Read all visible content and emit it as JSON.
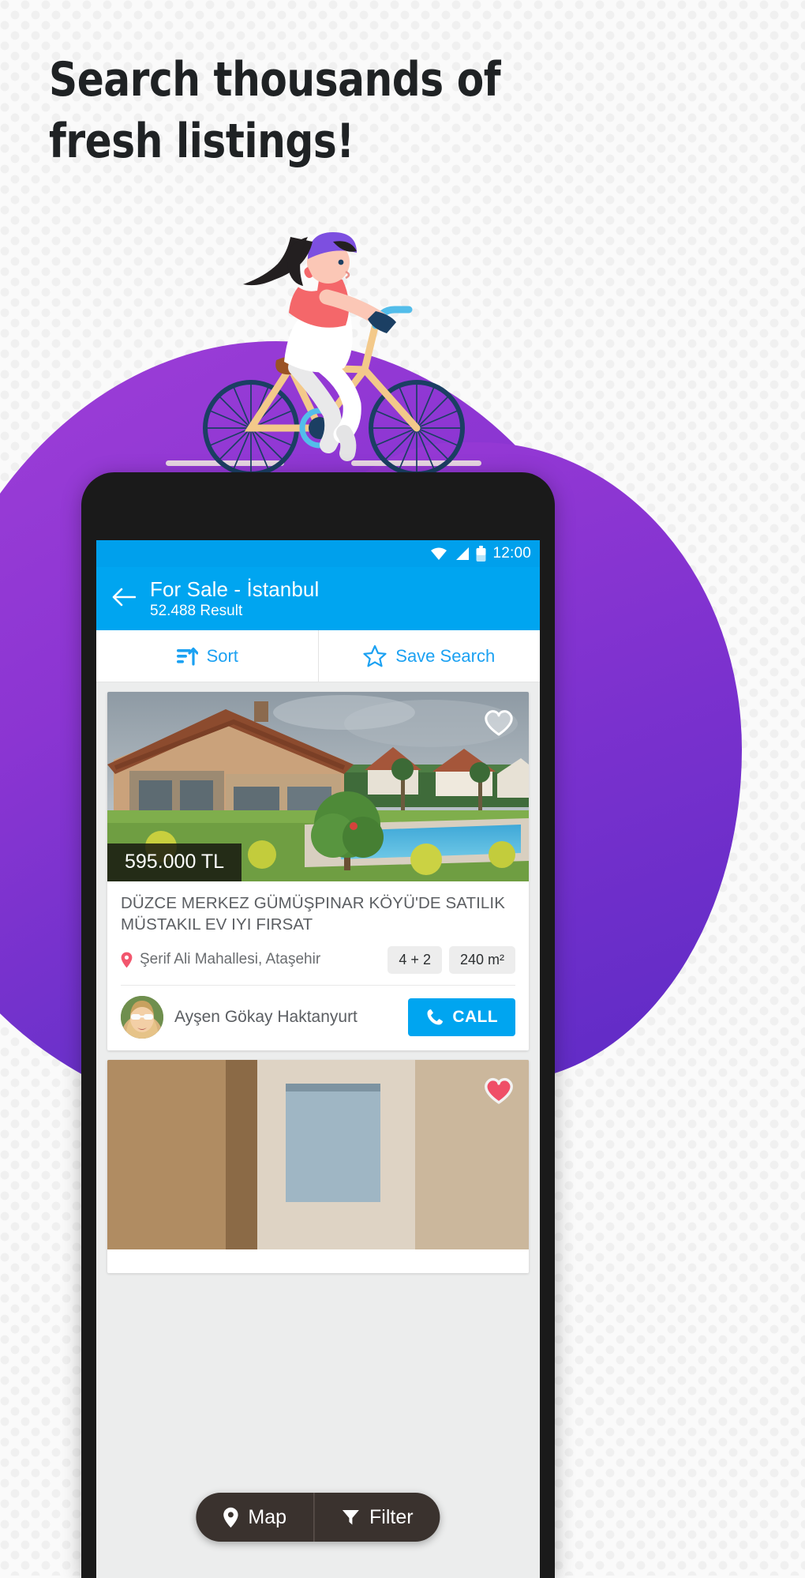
{
  "promo": {
    "headline": "Search thousands of\nfresh listings!",
    "illustration": "woman-riding-bicycle",
    "blob_color": "#7b31ce",
    "background_color": "#fafafa",
    "dot_color": "#f0f0f0"
  },
  "phone": {
    "frame_color": "#1a1a1a",
    "statusbar": {
      "time": "12:00",
      "background": "#00a0ec",
      "icons": [
        "wifi-icon",
        "signal-icon",
        "battery-icon"
      ]
    },
    "header": {
      "background": "#00a5f0",
      "back_icon": "back-arrow-icon",
      "title": "For Sale -  İstanbul",
      "subtitle": "52.488 Result"
    },
    "toolbar": {
      "accent": "#1ba1f2",
      "sort_label": "Sort",
      "sort_icon": "sort-lines-arrow-icon",
      "save_label": "Save Search",
      "save_icon": "star-outline-icon"
    },
    "listings": [
      {
        "price": "595.000 TL",
        "title": "DÜZCE MERKEZ GÜMÜŞPINAR KÖYÜ'DE SATILIK MÜSTAKIL EV IYI FIRSAT",
        "location": "Şerif Ali Mahallesi, Ataşehir",
        "location_icon": "map-pin-icon",
        "rooms": "4 + 2",
        "area": "240 m²",
        "favorite": false,
        "favorite_icon": "heart-outline-icon",
        "agent": "Ayşen Gökay Haktanyurt",
        "call_label": "CALL",
        "call_icon": "phone-icon"
      },
      {
        "favorite": true,
        "favorite_icon": "heart-filled-icon",
        "favorite_color": "#ef4e67"
      }
    ],
    "floating_bar": {
      "background": "#3a322e",
      "map_label": "Map",
      "map_icon": "map-pin-icon",
      "filter_label": "Filter",
      "filter_icon": "funnel-icon"
    }
  }
}
